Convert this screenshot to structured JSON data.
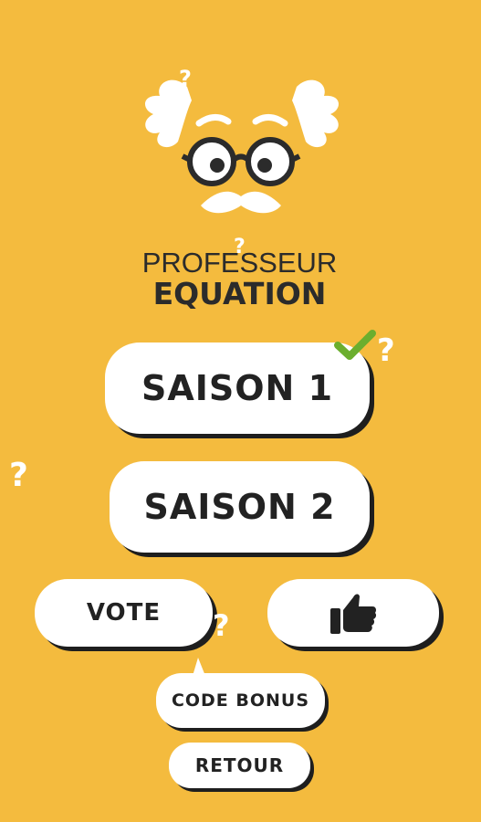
{
  "logo": {
    "line1": "PROFESSEUR",
    "line2": "EQUATION"
  },
  "buttons": {
    "season1": "SAISON 1",
    "season2": "SAISON 2",
    "vote": "VOTE",
    "code_bonus": "CODE BONUS",
    "retour": "RETOUR"
  },
  "icons": {
    "like": "thumbs-up-icon",
    "completed": "checkmark-icon",
    "decor": "question-mark-icon"
  },
  "colors": {
    "background": "#F4BB3E",
    "button": "#FFFFFF",
    "shadow": "#1E1E1E",
    "check": "#6BAE2E"
  },
  "decor": {
    "q": "?"
  }
}
